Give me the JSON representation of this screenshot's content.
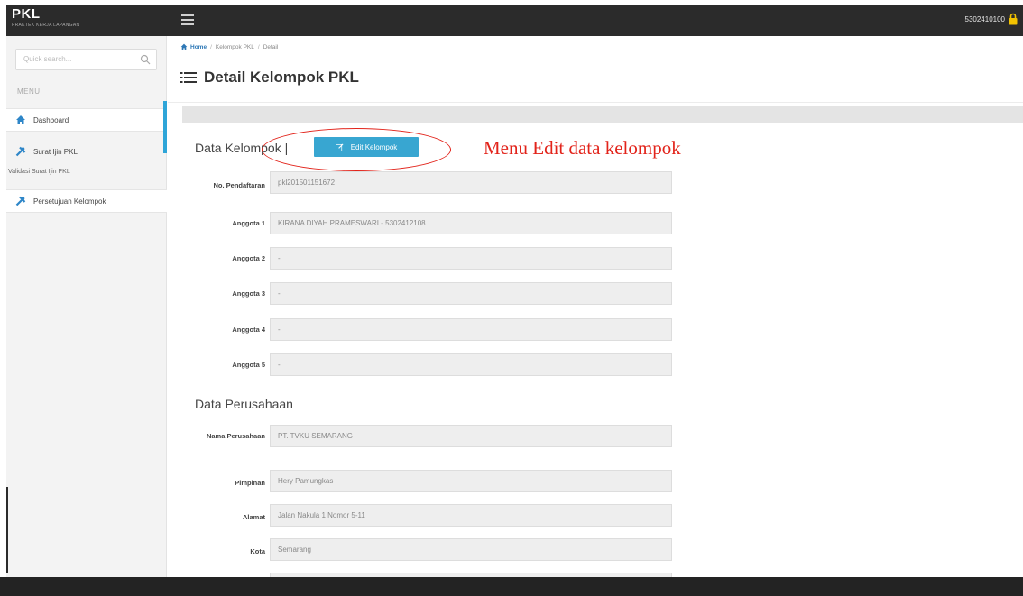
{
  "brand": {
    "title": "PKL",
    "subtitle": "PRAKTEK KERJA LAPANGAN"
  },
  "header": {
    "user_id": "5302410100"
  },
  "sidebar": {
    "search_placeholder": "Quick search...",
    "menu_label": "MENU",
    "items": [
      {
        "label": "Dashboard",
        "icon": "home-icon"
      },
      {
        "label": "Surat Ijin PKL",
        "icon": "tools-icon"
      },
      {
        "label": "Persetujuan Kelompok",
        "icon": "tools-icon"
      }
    ],
    "sub_item": "Validasi Surat Ijin PKL"
  },
  "breadcrumb": {
    "home": "Home",
    "level1": "Kelompok PKL",
    "level2": "Detail"
  },
  "page_title": "Detail Kelompok PKL",
  "kelompok": {
    "section_title": "Data Kelompok |",
    "edit_button": "Edit Kelompok",
    "fields": [
      {
        "label": "No. Pendaftaran",
        "value": "pkl201501151672"
      },
      {
        "label": "Anggota 1",
        "value": "KIRANA DIYAH PRAMESWARI - 5302412108"
      },
      {
        "label": "Anggota 2",
        "value": "-"
      },
      {
        "label": "Anggota 3",
        "value": "-"
      },
      {
        "label": "Anggota 4",
        "value": "-"
      },
      {
        "label": "Anggota 5",
        "value": "-"
      }
    ]
  },
  "perusahaan": {
    "section_title": "Data Perusahaan",
    "fields": [
      {
        "label": "Nama Perusahaan",
        "value": "PT. TVKU SEMARANG"
      },
      {
        "label": "Pimpinan",
        "value": "Hery Pamungkas"
      },
      {
        "label": "Alamat",
        "value": "Jalan Nakula 1 Nomor 5-11"
      },
      {
        "label": "Kota",
        "value": "Semarang"
      }
    ]
  },
  "annotation": {
    "text": "Menu Edit data kelompok",
    "color": "#e2231a"
  },
  "colors": {
    "accent": "#38a6d1",
    "topbar": "#2b2b2b"
  }
}
